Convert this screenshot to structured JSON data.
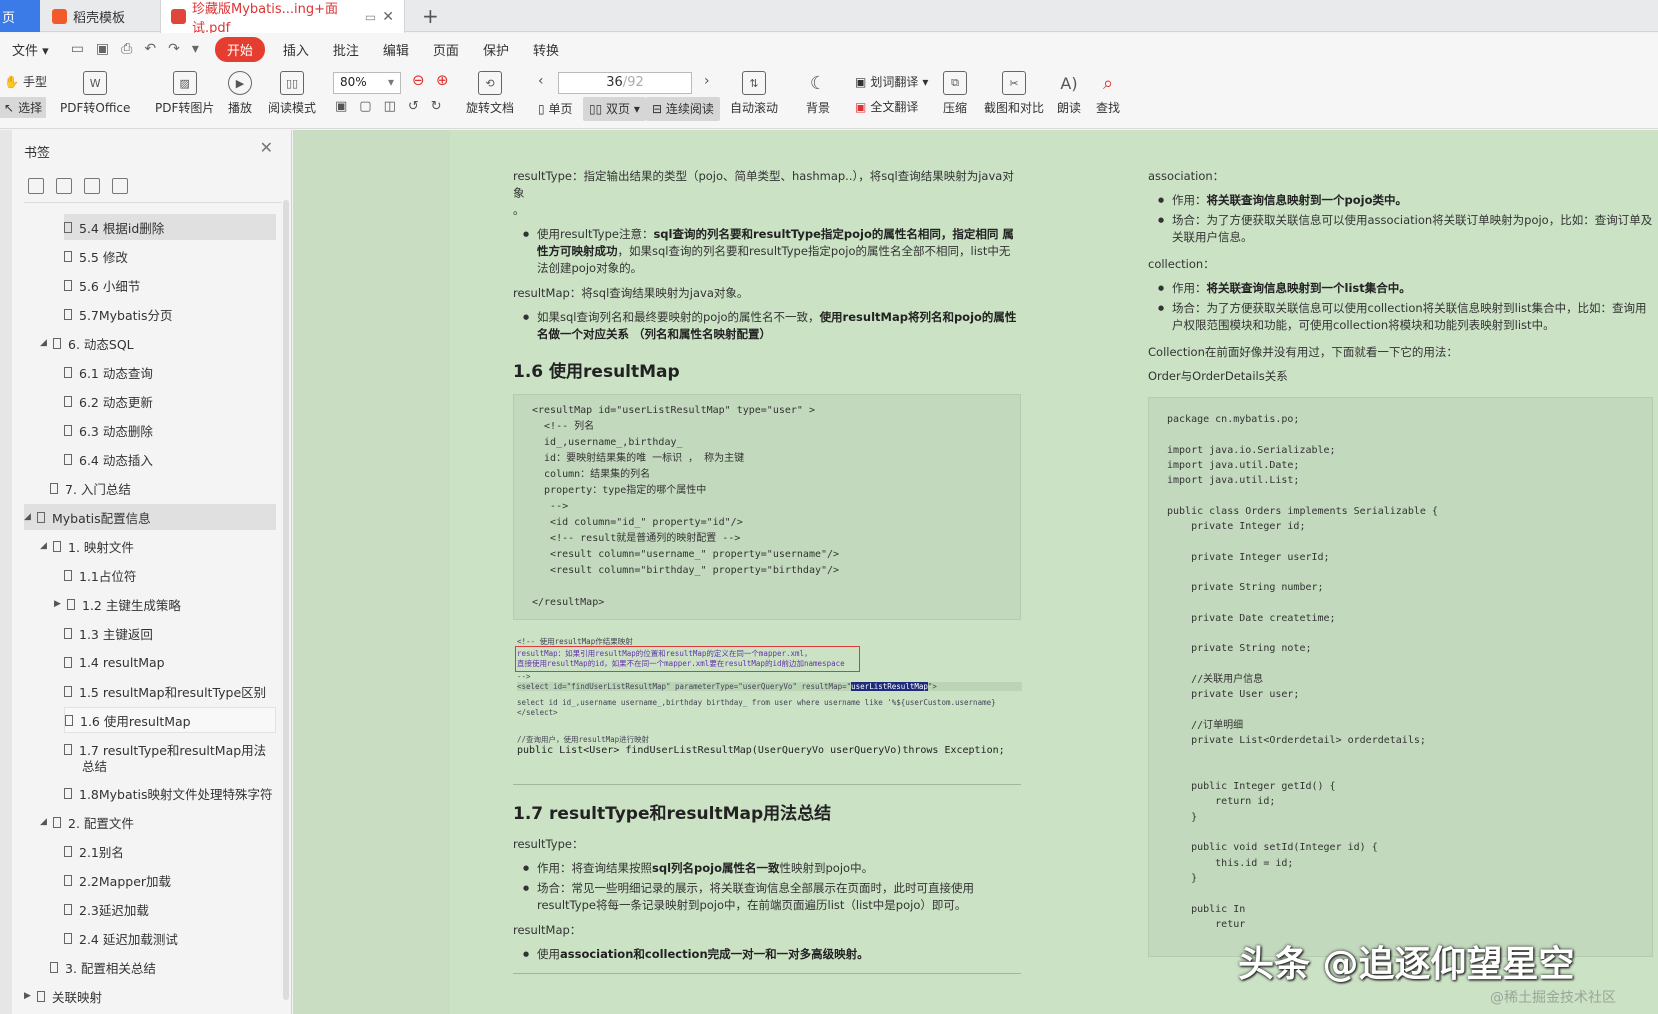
{
  "tabs": [
    {
      "label": "页"
    },
    {
      "label": "稻壳模板"
    },
    {
      "label": "珍藏版Mybatis...ing+面试.pdf"
    }
  ],
  "menu": {
    "file": "文件",
    "start": "开始",
    "items": [
      "插入",
      "批注",
      "编辑",
      "页面",
      "保护",
      "转换"
    ]
  },
  "ribbon": {
    "hand": "手型",
    "select": "选择",
    "pdf_office": "PDF转Office",
    "pdf_image": "PDF转图片",
    "play": "播放",
    "read_mode": "阅读模式",
    "zoom": "80%",
    "rotate": "旋转文档",
    "page_current": "36",
    "page_total": "/92",
    "single": "单页",
    "double": "双页",
    "continuous": "连续阅读",
    "auto_scroll": "自动滚动",
    "background": "背景",
    "word_translate": "划词翻译",
    "full_translate": "全文翻译",
    "compress": "压缩",
    "screenshot_compare": "截图和对比",
    "read_aloud": "朗读",
    "search": "查找"
  },
  "sidebar": {
    "title": "书签",
    "items": [
      {
        "label": "5.4 根据id删除"
      },
      {
        "label": "5.5 修改"
      },
      {
        "label": "5.6 小细节"
      },
      {
        "label": "5.7Mybatis分页"
      },
      {
        "label": "6. 动态SQL"
      },
      {
        "label": "6.1 动态查询"
      },
      {
        "label": "6.2 动态更新"
      },
      {
        "label": "6.3 动态删除"
      },
      {
        "label": "6.4 动态插入"
      },
      {
        "label": "7. 入门总结"
      },
      {
        "label": "Mybatis配置信息"
      },
      {
        "label": "1. 映射文件"
      },
      {
        "label": "1.1占位符"
      },
      {
        "label": "1.2 主键生成策略"
      },
      {
        "label": "1.3 主键返回"
      },
      {
        "label": "1.4 resultMap"
      },
      {
        "label": "1.5 resultMap和resultType区别"
      },
      {
        "label": "1.6 使用resultMap"
      },
      {
        "label": "1.7 resultType和resultMap用法"
      },
      {
        "label": "总结"
      },
      {
        "label": "1.8Mybatis映射文件处理特殊字符"
      },
      {
        "label": "2. 配置文件"
      },
      {
        "label": "2.1别名"
      },
      {
        "label": "2.2Mapper加载"
      },
      {
        "label": "2.3延迟加载"
      },
      {
        "label": "2.4 延迟加载测试"
      },
      {
        "label": "3. 配置相关总结"
      },
      {
        "label": "关联映射"
      }
    ]
  },
  "doc": {
    "col1": {
      "p1": "resultType：指定输出结果的类型（pojo、简单类型、hashmap..），将sql查询结果映射为java对象",
      "p1b": "。",
      "li1_a": "使用resultType注意：",
      "li1_b": "sql查询的列名要和resultType指定pojo的属性名相同，指定相同 属性方可映射成功",
      "li1_c": "，如果sql查询的列名要和resultType指定pojo的属性名全部不相同，list中无法创建pojo对象的。",
      "p2": "resultMap：将sql查询结果映射为java对象。",
      "li2_a": "如果sql查询列名和最终要映射的pojo的属性名不一致，",
      "li2_b": "使用resultMap将列名和pojo的属性名做一个对应关系 （列名和属性名映射配置）",
      "h16": "1.6 使用resultMap",
      "h17": "1.7 resultType和resultMap用法总结",
      "p3": "resultType：",
      "li3_a": "作用：将查询结果按照",
      "li3_b": "sql列名pojo属性名一致",
      "li3_c": "性映射到pojo中。",
      "li4": "场合：常见一些明细记录的展示，将关联查询信息全部展示在页面时，此时可直接使用resultType将每一条记录映射到pojo中，在前端页面遍历list（list中是pojo）即可。",
      "p4": "resultMap：",
      "li5_a": "使用",
      "li5_b": "association和collection完成一对一和一对多高级映射。"
    },
    "col2": {
      "p1": "association：",
      "li1_a": "作用：",
      "li1_b": "将关联查询信息映射到一个pojo类中。",
      "li2": "场合：为了方便获取关联信息可以使用association将关联订单映射为pojo，比如：查询订单及关联用户信息。",
      "p2": "collection：",
      "li3_a": "作用：",
      "li3_b": "将关联查询信息映射到一个list集合中。",
      "li4": "场合：为了方便获取关联信息可以使用collection将关联信息映射到list集合中，比如：查询用户权限范围模块和功能，可使用collection将模块和功能列表映射到list中。",
      "p3": "Collection在前面好像并没有用过，下面就看一下它的用法：",
      "p4": "Order与OrderDetails关系"
    },
    "xml_code": [
      "<resultMap id=\"userListResultMap\" type=\"user\" >",
      "  <!-- 列名",
      "  id_,username_,birthday_",
      "  id：要映射结果集的唯 一标识 ， 称为主键",
      "  column：结果集的列名",
      "  property：type指定的哪个属性中",
      "   -->",
      "   <id column=\"id_\" property=\"id\"/>",
      "   <!-- result就是普通列的映射配置 -->",
      "   <result column=\"username_\" property=\"username\"/>",
      "   <result column=\"birthday_\" property=\"birthday\"/>",
      "",
      "</resultMap>"
    ],
    "shot": {
      "l1": "<!-- 使用resultMap作结果映射",
      "l2": "resultMap：如果引用resultMap的位置和resultMap的定义在同一个mapper.xml，",
      "l3": "直接使用resultMap的id，如果不在同一个mapper.xml要在resultMap的id前边加namespace",
      "l4": " -->",
      "l5a": "<select id=\"findUserListResultMap\" parameterType=\"userQueryVo\" resultMap=\"",
      "l5b": "userListResultMap",
      "l5c": "\">",
      "l6": "    select id id_,username username_,birthday birthday_ from user where username like '%${userCustom.username}",
      "l7": "</select>",
      "l8": "//查询用户，使用resultMap进行映射",
      "l9": "public List<User> findUserListResultMap(UserQueryVo userQueryVo)throws Exception;"
    },
    "java_code": [
      "package cn.mybatis.po;",
      "",
      "import java.io.Serializable;",
      "import java.util.Date;",
      "import java.util.List;",
      "",
      "public class Orders implements Serializable {",
      "    private Integer id;",
      "",
      "    private Integer userId;",
      "",
      "    private String number;",
      "",
      "    private Date createtime;",
      "",
      "    private String note;",
      "",
      "    //关联用户信息",
      "    private User user;",
      "",
      "    //订单明细",
      "    private List<Orderdetail> orderdetails;",
      "",
      "",
      "    public Integer getId() {",
      "        return id;",
      "    }",
      "",
      "    public void setId(Integer id) {",
      "        this.id = id;",
      "    }",
      "",
      "    public In",
      "        retur"
    ]
  },
  "watermark": {
    "main": "头条 @追逐仰望星空",
    "sub": "@稀土掘金技术社区"
  }
}
